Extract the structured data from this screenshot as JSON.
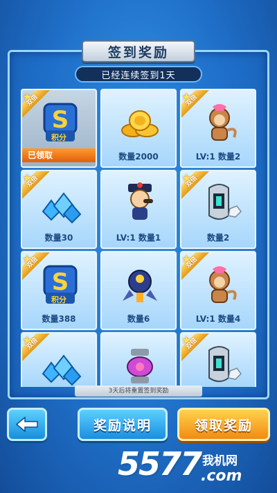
{
  "header": {
    "title": "签到奖励",
    "subtitle": "已经连续签到1天"
  },
  "badge_text": "双倍",
  "rewards": [
    {
      "icon": "score-s-icon",
      "label": "积分",
      "claimed_text": "已领取",
      "caption": ""
    },
    {
      "icon": "gold-coins-icon",
      "label": "",
      "caption": "数量2000"
    },
    {
      "icon": "pet-monkey-icon",
      "label": "",
      "caption": "LV:1 数量2"
    },
    {
      "icon": "blue-crystal-icon",
      "label": "",
      "caption": "数量30"
    },
    {
      "icon": "character-hat-icon",
      "label": "",
      "caption": "LV:1 数量1"
    },
    {
      "icon": "robot-armor-icon",
      "label": "",
      "caption": "数量2"
    },
    {
      "icon": "score-s-icon",
      "label": "积分",
      "caption": "数量388"
    },
    {
      "icon": "rocket-pod-icon",
      "label": "",
      "caption": "数量6"
    },
    {
      "icon": "pet-monkey-icon",
      "label": "",
      "caption": "LV:1 数量4"
    },
    {
      "icon": "blue-crystal-icon",
      "label": "",
      "caption": ""
    },
    {
      "icon": "mech-core-icon",
      "label": "",
      "caption": ""
    },
    {
      "icon": "robot-armor-icon",
      "label": "",
      "caption": ""
    }
  ],
  "footer_note": "3天后将重置签到奖励",
  "buttons": {
    "info": "奖励说明",
    "claim": "领取奖励"
  },
  "watermark": {
    "number": "5577",
    "cn": "我机网",
    "domain": ".com"
  },
  "colors": {
    "background": "#1f6fc8",
    "claim_button": "#f28a12",
    "info_button": "#1a8ee0",
    "badge": "#e49a12"
  }
}
